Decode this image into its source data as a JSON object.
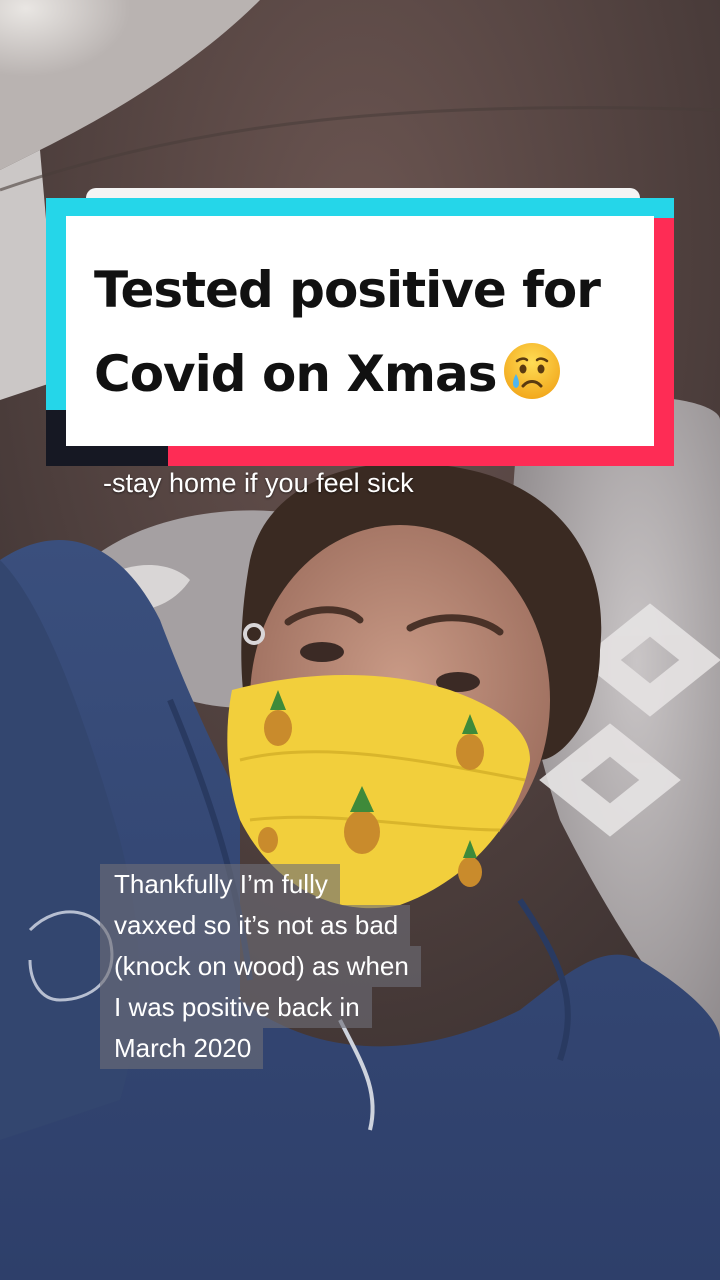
{
  "title_card": {
    "line1": "Tested positive for",
    "line2": "Covid on Xmas",
    "emoji": "crying-face-emoji",
    "colors": {
      "cyan": "#25d6e9",
      "red": "#fe2c55",
      "dark": "#161823",
      "white": "#ffffff"
    }
  },
  "captions": {
    "top": "-stay home if you feel sick",
    "bottom_lines": [
      "Thankfully I’m fully",
      "vaxxed so it’s not as bad",
      "(knock on wood) as when",
      "I was positive back in",
      "March 2020"
    ]
  },
  "scene": {
    "subject": "person-lying-in-bed-wearing-pineapple-face-mask",
    "mask_color": "#f2cf3c",
    "hoodie_color": "#3c5282"
  }
}
